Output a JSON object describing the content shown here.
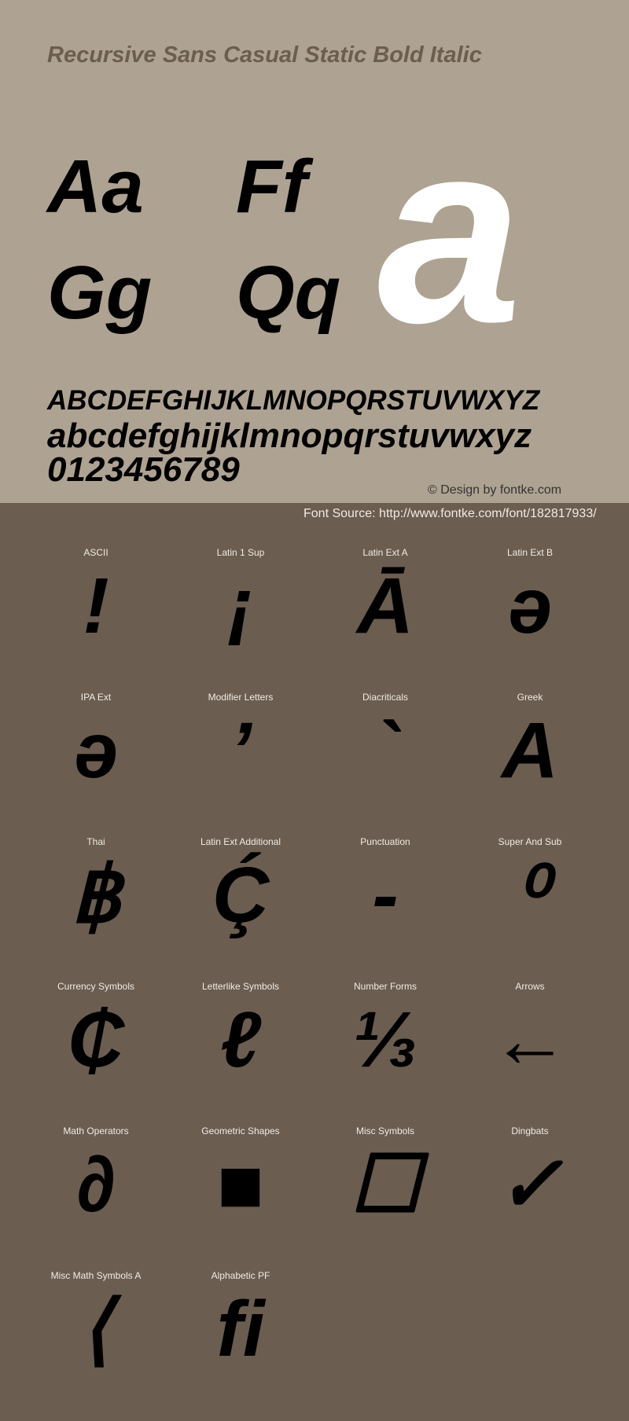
{
  "header": {
    "title": "Recursive Sans Casual Static Bold Italic"
  },
  "specimen": {
    "pairs": [
      "Aa",
      "Ff",
      "Gg",
      "Qq"
    ],
    "big_glyph": "a",
    "uppercase": "ABCDEFGHIJKLMNOPQRSTUVWXYZ",
    "lowercase": "abcdefghijklmnopqrstuvwxyz",
    "digits": "0123456789",
    "credit": "© Design by fontke.com"
  },
  "source": "Font Source: http://www.fontke.com/font/182817933/",
  "colors": {
    "top_bg": "#aea292",
    "bottom_bg": "#6b5d50",
    "title": "#6b5d50"
  },
  "blocks": [
    {
      "label": "ASCII",
      "glyph": "!"
    },
    {
      "label": "Latin 1 Sup",
      "glyph": "¡"
    },
    {
      "label": "Latin Ext A",
      "glyph": "Ā"
    },
    {
      "label": "Latin Ext B",
      "glyph": "ə"
    },
    {
      "label": "IPA Ext",
      "glyph": "ə"
    },
    {
      "label": "Modifier Letters",
      "glyph": "ʼ"
    },
    {
      "label": "Diacriticals",
      "glyph": "`"
    },
    {
      "label": "Greek",
      "glyph": "Α"
    },
    {
      "label": "Thai",
      "glyph": "฿"
    },
    {
      "label": "Latin Ext Additional",
      "glyph": "Ḉ"
    },
    {
      "label": "Punctuation",
      "glyph": "‐"
    },
    {
      "label": "Super And Sub",
      "glyph": "⁰"
    },
    {
      "label": "Currency Symbols",
      "glyph": "₵"
    },
    {
      "label": "Letterlike Symbols",
      "glyph": "ℓ"
    },
    {
      "label": "Number Forms",
      "glyph": "⅓"
    },
    {
      "label": "Arrows",
      "glyph": "←"
    },
    {
      "label": "Math Operators",
      "glyph": "∂"
    },
    {
      "label": "Geometric Shapes",
      "glyph": "■"
    },
    {
      "label": "Misc Symbols",
      "glyph": "☐"
    },
    {
      "label": "Dingbats",
      "glyph": "✓"
    },
    {
      "label": "Misc Math Symbols A",
      "glyph": "⟨"
    },
    {
      "label": "Alphabetic PF",
      "glyph": "ﬁ"
    }
  ]
}
